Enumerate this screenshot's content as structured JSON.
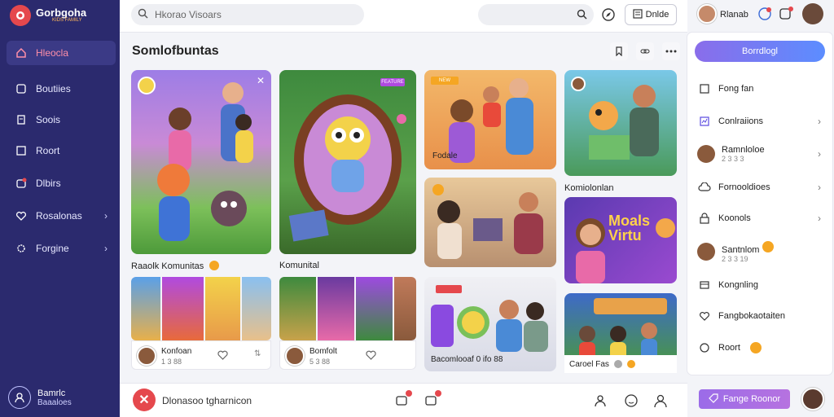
{
  "app": {
    "name": "Gorbgoha",
    "tagline": "KIDS FAMILY"
  },
  "sidebar": {
    "items": [
      {
        "label": "Hleocla",
        "icon": "home-icon",
        "active": true
      },
      {
        "label": "Boutiies",
        "icon": "box-icon"
      },
      {
        "label": "Soois",
        "icon": "doc-icon"
      },
      {
        "label": "Roort",
        "icon": "square-icon"
      },
      {
        "label": "Dlbirs",
        "icon": "alert-box-icon"
      },
      {
        "label": "Rosalonas",
        "icon": "heart-icon",
        "chevron": true
      },
      {
        "label": "Forgine",
        "icon": "gear-icon",
        "chevron": true
      }
    ],
    "user": {
      "line1": "Bamrlc",
      "line2": "Baaaloes"
    }
  },
  "topbar": {
    "search_placeholder": "Hkorao Visoars",
    "button_label": "Dnlde"
  },
  "main": {
    "title": "Somlofbuntas",
    "feature_cards": [
      {
        "caption": "Raaolk Komunitas",
        "tag": ""
      },
      {
        "caption": "Komunital",
        "tag": "FEATURE"
      }
    ],
    "side_cards": [
      {
        "caption": "Fodale",
        "tag": "NEW"
      },
      {
        "caption": "Komiolonlan",
        "tag": ""
      },
      {
        "caption": "Bacomlooaf 0 ifo 88",
        "tag": ""
      },
      {
        "caption": "Caroel Fas",
        "tag": ""
      }
    ],
    "minis": [
      {
        "name": "Konfoan",
        "count": "1 3 88"
      },
      {
        "name": "Bomfolt",
        "count": "5 3 88"
      }
    ],
    "mini_card_text": "Moals Virtu"
  },
  "bottombar": {
    "text": "Dlonasoo tgharnicon"
  },
  "right": {
    "user_name": "Rlanab",
    "primary_button": "Borrdlogl",
    "items": [
      {
        "label": "Fong fan",
        "icon": "doc-icon"
      },
      {
        "label": "Conlraiions",
        "icon": "chart-icon",
        "chevron": true
      },
      {
        "label": "Ramnloloe",
        "sub": "2 3 3 3",
        "avatar": true,
        "chevron": true
      },
      {
        "label": "Fornooldioes",
        "icon": "cloud-icon",
        "chevron": true
      },
      {
        "label": "Koonols",
        "icon": "lock-icon",
        "chevron": true
      },
      {
        "label": "Santnlom",
        "sub": "2 3 3 19",
        "avatar": true,
        "fire": true
      },
      {
        "label": "Kongnling",
        "icon": "box-icon"
      },
      {
        "label": "Fangbokaotaiten",
        "icon": "heart-icon"
      },
      {
        "label": "Roort",
        "icon": "globe-icon",
        "fire": true
      }
    ],
    "bottom_button": "Fange Roonor"
  },
  "colors": {
    "sidebar": "#2b2a6e",
    "accent": "#e5484d",
    "purple": "#8a6dea"
  }
}
